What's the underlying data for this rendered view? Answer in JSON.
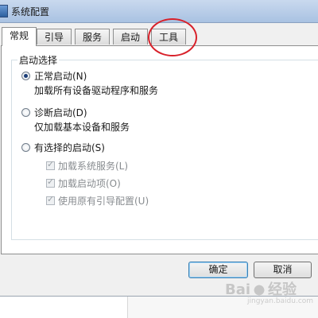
{
  "window": {
    "title": "系统配置"
  },
  "tabs": [
    {
      "label": "常规",
      "active": true
    },
    {
      "label": "引导"
    },
    {
      "label": "服务"
    },
    {
      "label": "启动"
    },
    {
      "label": "工具"
    }
  ],
  "startup": {
    "group_title": "启动选择",
    "normal": {
      "label": "正常启动(N)",
      "desc": "加载所有设备驱动程序和服务",
      "selected": true
    },
    "diagnostic": {
      "label": "诊断启动(D)",
      "desc": "仅加载基本设备和服务"
    },
    "selective": {
      "label": "有选择的启动(S)",
      "options": [
        {
          "label": "加载系统服务(L)",
          "checked": true,
          "enabled": false
        },
        {
          "label": "加载启动项(O)",
          "checked": true,
          "enabled": false
        },
        {
          "label": "使用原有引导配置(U)",
          "checked": true,
          "enabled": false
        }
      ]
    }
  },
  "buttons": {
    "ok": "确定",
    "cancel": "取消"
  },
  "watermark": {
    "logo_text": "Bai",
    "logo_text2": "经验",
    "sub": "jingyan.baidu.com"
  },
  "annotation_color": "#d8212a"
}
